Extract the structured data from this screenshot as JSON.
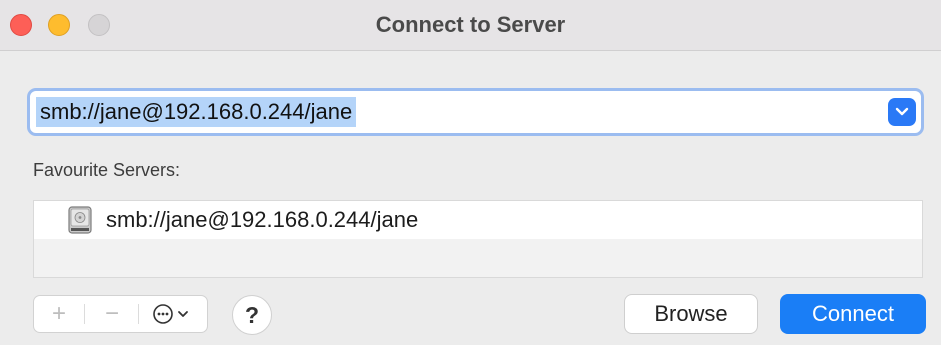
{
  "window": {
    "title": "Connect to Server"
  },
  "address": {
    "value": "smb://jane@192.168.0.244/jane",
    "dropdown_icon": "chevron-down-icon"
  },
  "favourites": {
    "label": "Favourite Servers:",
    "items": [
      {
        "label": "smb://jane@192.168.0.244/jane",
        "icon": "network-drive-icon"
      }
    ]
  },
  "toolbar": {
    "add_label": "+",
    "remove_label": "−",
    "more_icon": "ellipsis-circle-icon",
    "help_label": "?",
    "browse_label": "Browse",
    "connect_label": "Connect"
  },
  "colors": {
    "accent": "#1a7ef6",
    "selection": "#b4d4f9",
    "close": "#fd5f57",
    "minimize": "#febc2e"
  }
}
